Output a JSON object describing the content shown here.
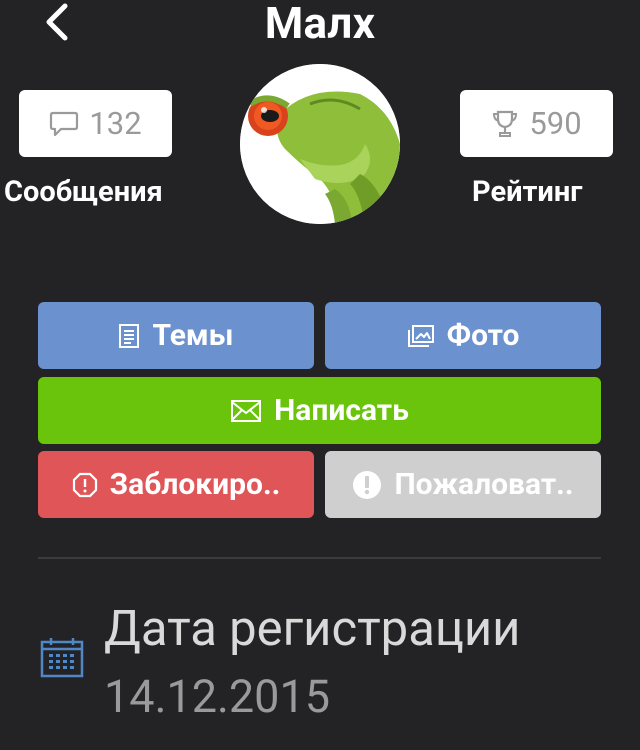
{
  "header": {
    "back_icon": "chevron-left-icon",
    "title": "Малх"
  },
  "stats": {
    "messages": {
      "icon": "speech-bubble-icon",
      "count": "132",
      "label": "Сообщения"
    },
    "rating": {
      "icon": "trophy-icon",
      "count": "590",
      "label": "Рейтинг"
    }
  },
  "avatar": {
    "description_icon": "frog-avatar"
  },
  "actions": {
    "topics": {
      "icon": "document-icon",
      "label": "Темы",
      "color": "#6b92cf"
    },
    "photo": {
      "icon": "photo-icon",
      "label": "Фото",
      "color": "#6b92cf"
    },
    "write": {
      "icon": "envelope-icon",
      "label": "Написать",
      "color": "#69c40b"
    },
    "block": {
      "icon": "stop-octagon-icon",
      "label": "Заблокиро..",
      "color": "#e05557"
    },
    "report": {
      "icon": "exclamation-circle-icon",
      "label": "Пожаловат..",
      "color": "#cfcfcf"
    }
  },
  "registration": {
    "icon": "calendar-icon",
    "title": "Дата регистрации",
    "date": "14.12.2015"
  }
}
